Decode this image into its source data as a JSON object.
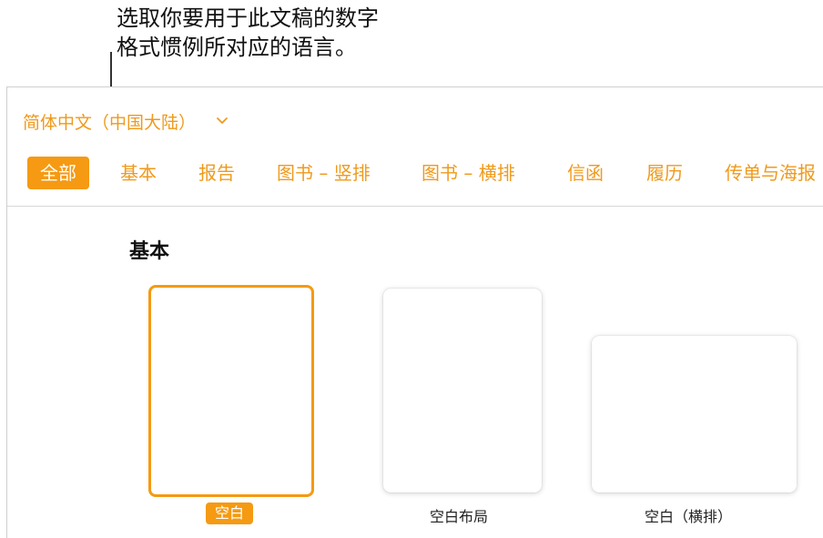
{
  "callout": {
    "line1": "选取你要用于此文稿的数字",
    "line2": "格式惯例所对应的语言。"
  },
  "language_selector": {
    "value": "简体中文（中国大陆）",
    "icon": "chevron-down-icon"
  },
  "tabs": [
    {
      "label": "全部",
      "active": true
    },
    {
      "label": "基本",
      "active": false
    },
    {
      "label": "报告",
      "active": false
    },
    {
      "label": "图书 – 竖排",
      "active": false
    },
    {
      "label": "图书 – 横排",
      "active": false
    },
    {
      "label": "信函",
      "active": false
    },
    {
      "label": "履历",
      "active": false
    },
    {
      "label": "传单与海报",
      "active": false
    }
  ],
  "section": {
    "title": "基本",
    "templates": [
      {
        "label": "空白",
        "selected": true
      },
      {
        "label": "空白布局",
        "selected": false
      },
      {
        "label": "空白（横排）",
        "selected": false
      }
    ]
  },
  "colors": {
    "accent": "#f59a12",
    "accent_text": "#ef9a1c"
  }
}
